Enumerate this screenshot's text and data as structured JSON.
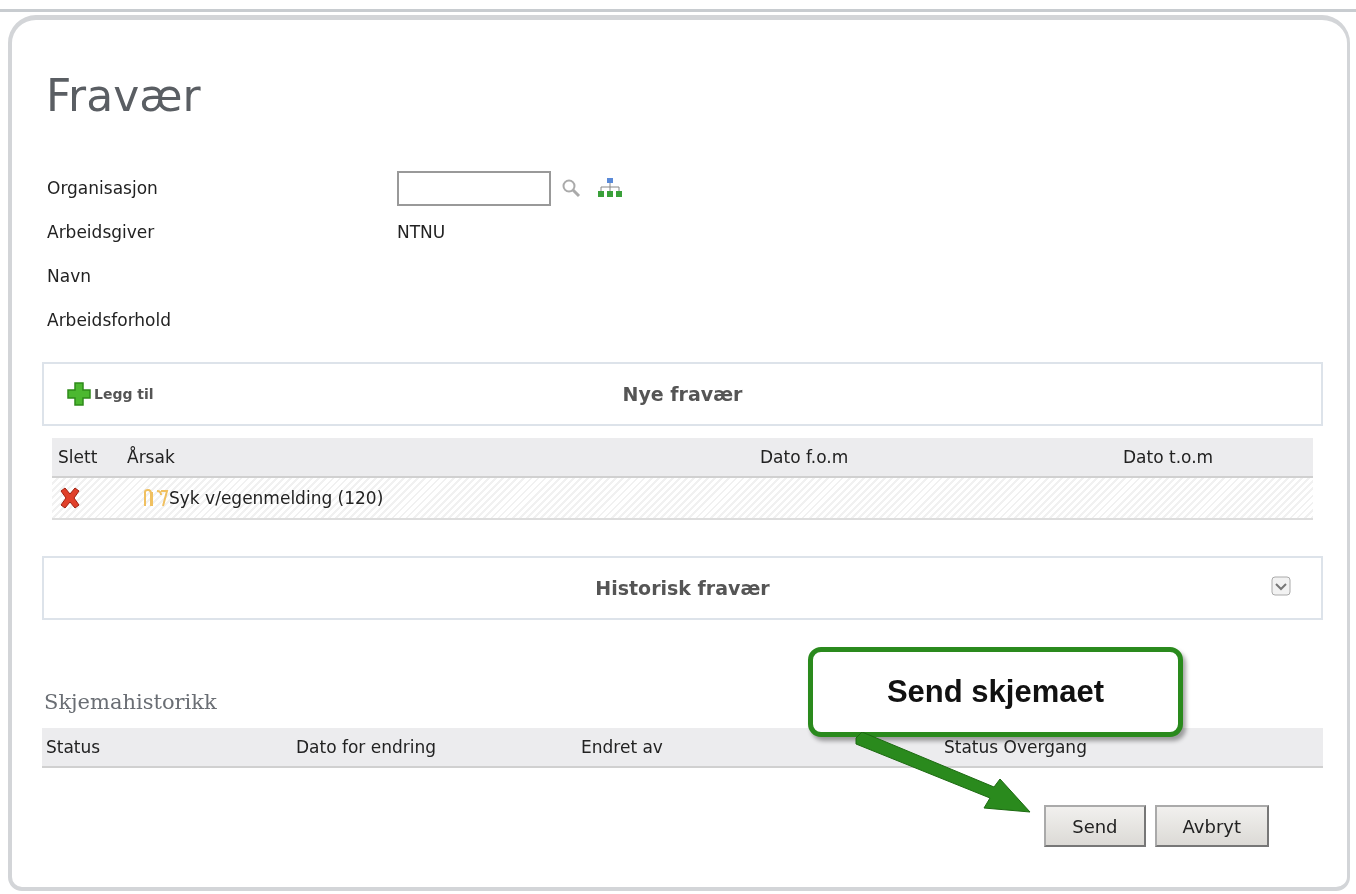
{
  "page": {
    "title": "Fravær"
  },
  "fields": [
    {
      "label": "Organisasjon",
      "kind": "lookup"
    },
    {
      "label": "Arbeidsgiver",
      "kind": "text",
      "value": "NTNU"
    },
    {
      "label": "Navn",
      "kind": "text"
    },
    {
      "label": "Arbeidsforhold",
      "kind": "text"
    }
  ],
  "new_absences": {
    "add_label": "Legg til",
    "title": "Nye fravær",
    "columns": [
      "Slett",
      "Årsak",
      "Dato f.o.m",
      "Dato t.o.m"
    ],
    "rows": [
      {
        "reason": "Syk v/egenmelding (120)"
      }
    ]
  },
  "history_panel": {
    "title": "Historisk fravær",
    "expanded": false
  },
  "form_history": {
    "title": "Skjemahistorikk",
    "columns": [
      "Status",
      "Dato for endring",
      "Endret av",
      "Status Overgang"
    ]
  },
  "buttons": [
    "Send",
    "Avbryt"
  ],
  "callout": {
    "text": "Send skjemaet"
  }
}
